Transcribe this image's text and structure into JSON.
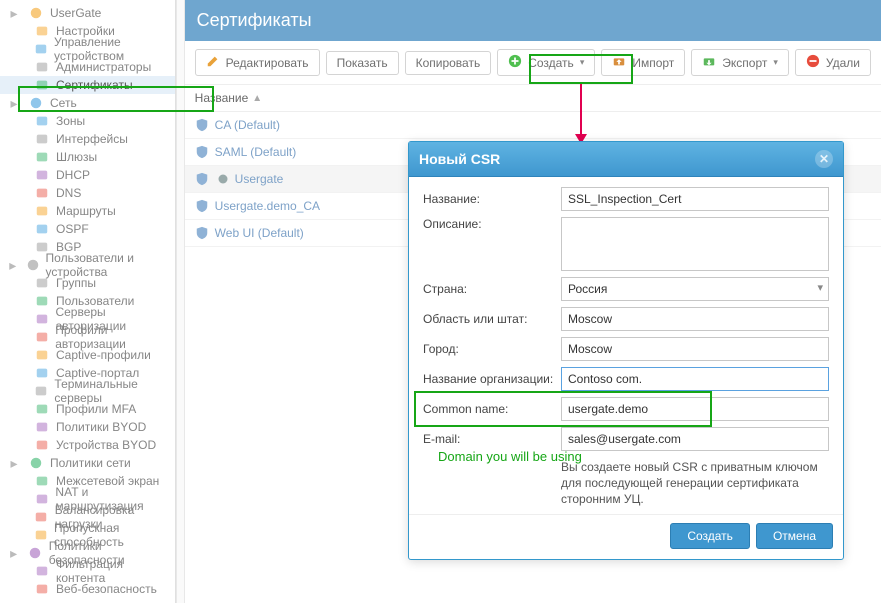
{
  "sidebar": {
    "groups": [
      {
        "label": "UserGate",
        "icon": "gear-icon",
        "items": [
          {
            "label": "Настройки",
            "icon": "gear-icon"
          },
          {
            "label": "Управление устройством",
            "icon": "device-icon"
          },
          {
            "label": "Администраторы",
            "icon": "users-icon"
          },
          {
            "label": "Сертификаты",
            "icon": "card-icon",
            "active": true
          }
        ]
      },
      {
        "label": "Сеть",
        "icon": "globe-icon",
        "items": [
          {
            "label": "Зоны",
            "icon": "zones-icon"
          },
          {
            "label": "Интерфейсы",
            "icon": "interfaces-icon"
          },
          {
            "label": "Шлюзы",
            "icon": "gateway-icon"
          },
          {
            "label": "DHCP",
            "icon": "dhcp-icon"
          },
          {
            "label": "DNS",
            "icon": "dns-icon"
          },
          {
            "label": "Маршруты",
            "icon": "routes-icon"
          },
          {
            "label": "OSPF",
            "icon": "ospf-icon"
          },
          {
            "label": "BGP",
            "icon": "bgp-icon"
          }
        ]
      },
      {
        "label": "Пользователи и устройства",
        "icon": "user-icon",
        "items": [
          {
            "label": "Группы",
            "icon": "groups-icon"
          },
          {
            "label": "Пользователи",
            "icon": "user-icon"
          },
          {
            "label": "Серверы авторизации",
            "icon": "server-icon"
          },
          {
            "label": "Профили авторизации",
            "icon": "profile-icon"
          },
          {
            "label": "Captive-профили",
            "icon": "captive-icon"
          },
          {
            "label": "Captive-портал",
            "icon": "portal-icon"
          },
          {
            "label": "Терминальные серверы",
            "icon": "terminal-icon"
          },
          {
            "label": "Профили MFA",
            "icon": "mfa-icon"
          },
          {
            "label": "Политики BYOD",
            "icon": "byod-icon"
          },
          {
            "label": "Устройства BYOD",
            "icon": "device-icon"
          }
        ]
      },
      {
        "label": "Политики сети",
        "icon": "policy-icon",
        "items": [
          {
            "label": "Межсетевой экран",
            "icon": "firewall-icon"
          },
          {
            "label": "NAT и маршрутизация",
            "icon": "nat-icon"
          },
          {
            "label": "Балансировка нагрузки",
            "icon": "balance-icon"
          },
          {
            "label": "Пропускная способность",
            "icon": "bandwidth-icon"
          }
        ]
      },
      {
        "label": "Политики безопасности",
        "icon": "shield-icon",
        "items": [
          {
            "label": "Фильтрация контента",
            "icon": "filter-icon"
          },
          {
            "label": "Веб-безопасность",
            "icon": "web-icon"
          }
        ]
      }
    ]
  },
  "page": {
    "title": "Сертификаты",
    "toolbar": {
      "edit": "Редактировать",
      "show": "Показать",
      "copy": "Копировать",
      "create": "Создать",
      "import": "Импорт",
      "export": "Экспорт",
      "delete": "Удали"
    },
    "table": {
      "header_name": "Название",
      "rows": [
        {
          "name": "CA (Default)"
        },
        {
          "name": "SAML (Default)"
        },
        {
          "name": "Usergate",
          "selected": true
        },
        {
          "name": "Usergate.demo_CA"
        },
        {
          "name": "Web UI (Default)"
        }
      ]
    }
  },
  "dialog": {
    "title": "Новый CSR",
    "labels": {
      "name": "Название:",
      "description": "Описание:",
      "country": "Страна:",
      "state": "Область или штат:",
      "city": "Город:",
      "org": "Название организации:",
      "cn": "Common name:",
      "email": "E-mail:"
    },
    "values": {
      "name": "SSL_Inspection_Cert",
      "description": "",
      "country": "Россия",
      "state": "Moscow",
      "city": "Moscow",
      "org": "Contoso com.",
      "cn": "usergate.demo",
      "email": "sales@usergate.com"
    },
    "info": "Вы создаете новый CSR с приватным ключом для последующей генерации сертификата сторонним УЦ.",
    "buttons": {
      "create": "Создать",
      "cancel": "Отмена"
    },
    "annotation": "Domain you will be using"
  },
  "icons": {
    "colors": [
      "#f39c12",
      "#3498db",
      "#8e8e8e",
      "#27ae60",
      "#9b59b6",
      "#e74c3c"
    ]
  }
}
